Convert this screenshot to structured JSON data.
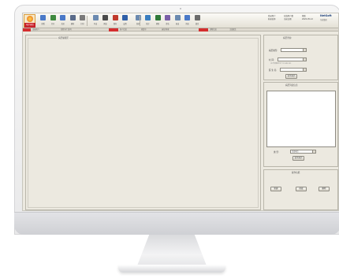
{
  "toolbar": {
    "logo_text": "电子病历",
    "tools": [
      {
        "label": "查看",
        "color": "#4a79c8"
      },
      {
        "label": "打开",
        "color": "#3f8a3f"
      },
      {
        "label": "关闭",
        "color": "#4a79c8"
      },
      {
        "label": "刷新",
        "color": "#5a6b8a"
      },
      {
        "label": "打印",
        "color": "#7a7a7a"
      },
      {
        "label": "导出",
        "color": "#6b8ab0"
      },
      {
        "label": "预览",
        "color": "#4a4a4a"
      },
      {
        "label": "保存",
        "color": "#c0392b"
      },
      {
        "label": "设置",
        "color": "#2f5fa8"
      },
      {
        "label": "查找",
        "color": "#6b8ab0"
      },
      {
        "label": "统计",
        "color": "#3a7ec0"
      },
      {
        "label": "帮助",
        "color": "#2f7a3a"
      },
      {
        "label": "签名",
        "color": "#7a5fa8"
      },
      {
        "label": "退出",
        "color": "#6b8ab0"
      },
      {
        "label": "消息",
        "color": "#4a79c8"
      },
      {
        "label": "锁定",
        "color": "#6b6b6b"
      }
    ],
    "status_left": [
      "登录用户",
      "科室名称"
    ],
    "status_mid": [
      "在线用户数",
      "当前日期"
    ],
    "status_right": [
      "帮助",
      "2020-05-12"
    ],
    "brand": "NetSoft",
    "brand_sub": "东软集团"
  },
  "strip": {
    "items": [
      "当前病人:",
      "住院号/门诊号",
      "病人信息",
      "病案号",
      "床位/科室",
      "诊断信息",
      "主治医生"
    ]
  },
  "main": {
    "title": "病历编辑区"
  },
  "right": {
    "query_title": "病历查询",
    "query_name_label": "病历类型:",
    "query_date_label": "时  间:",
    "query_date_hint": "注:时间格式为YYYY-MM-DD",
    "query_doctor_label": "医 生 名:",
    "query_button": "显示病历",
    "list_title": "病历列表信息",
    "filter_label": "类 型:",
    "filter_value": "全部病历",
    "filter_button": "显示病历",
    "actions_title": "操作功能",
    "action_buttons": [
      "新建",
      "修改",
      "删除"
    ]
  }
}
